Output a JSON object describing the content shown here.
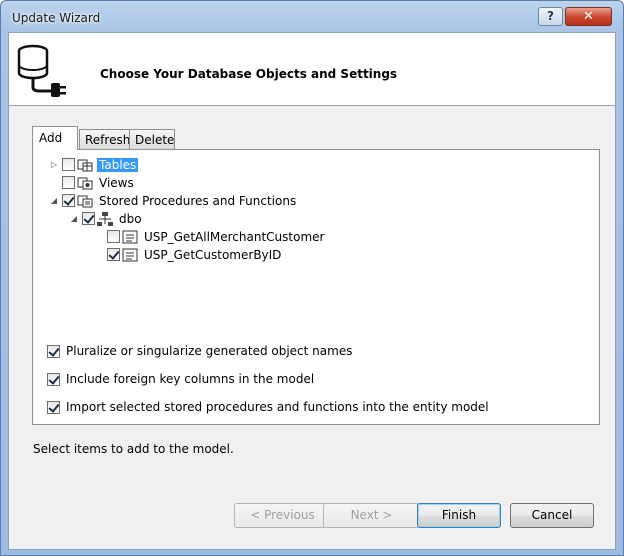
{
  "window": {
    "title": "Update Wizard",
    "help_label": "?",
    "close_label": "✕"
  },
  "header": {
    "title": "Choose Your Database Objects and Settings",
    "icon": "database-connection-icon"
  },
  "tabs": [
    {
      "label": "Add",
      "active": true
    },
    {
      "label": "Refresh",
      "active": false
    },
    {
      "label": "Delete",
      "active": false
    }
  ],
  "tree": {
    "tables": {
      "label": "Tables",
      "checked": false,
      "selected": true,
      "expander": "collapsed"
    },
    "views": {
      "label": "Views",
      "checked": false
    },
    "procs": {
      "label": "Stored Procedures and Functions",
      "checked": true,
      "expander": "expanded"
    },
    "dbo": {
      "label": "dbo",
      "checked": true,
      "expander": "expanded"
    },
    "proc1": {
      "label": "USP_GetAllMerchantCustomer",
      "checked": false
    },
    "proc2": {
      "label": "USP_GetCustomerByID",
      "checked": true
    }
  },
  "options": {
    "pluralize": {
      "label": "Pluralize or singularize generated object names",
      "checked": true
    },
    "foreign_keys": {
      "label": "Include foreign key columns in the model",
      "checked": true
    },
    "import_procs": {
      "label": "Import selected stored procedures and functions into the entity model",
      "checked": true
    }
  },
  "status": "Select items to add to the model.",
  "buttons": {
    "previous": "< Previous",
    "next": "Next >",
    "finish": "Finish",
    "cancel": "Cancel"
  },
  "colors": {
    "selection": "#3399ff",
    "title_bar": "#a9c4e6",
    "close_button": "#c9452e"
  }
}
